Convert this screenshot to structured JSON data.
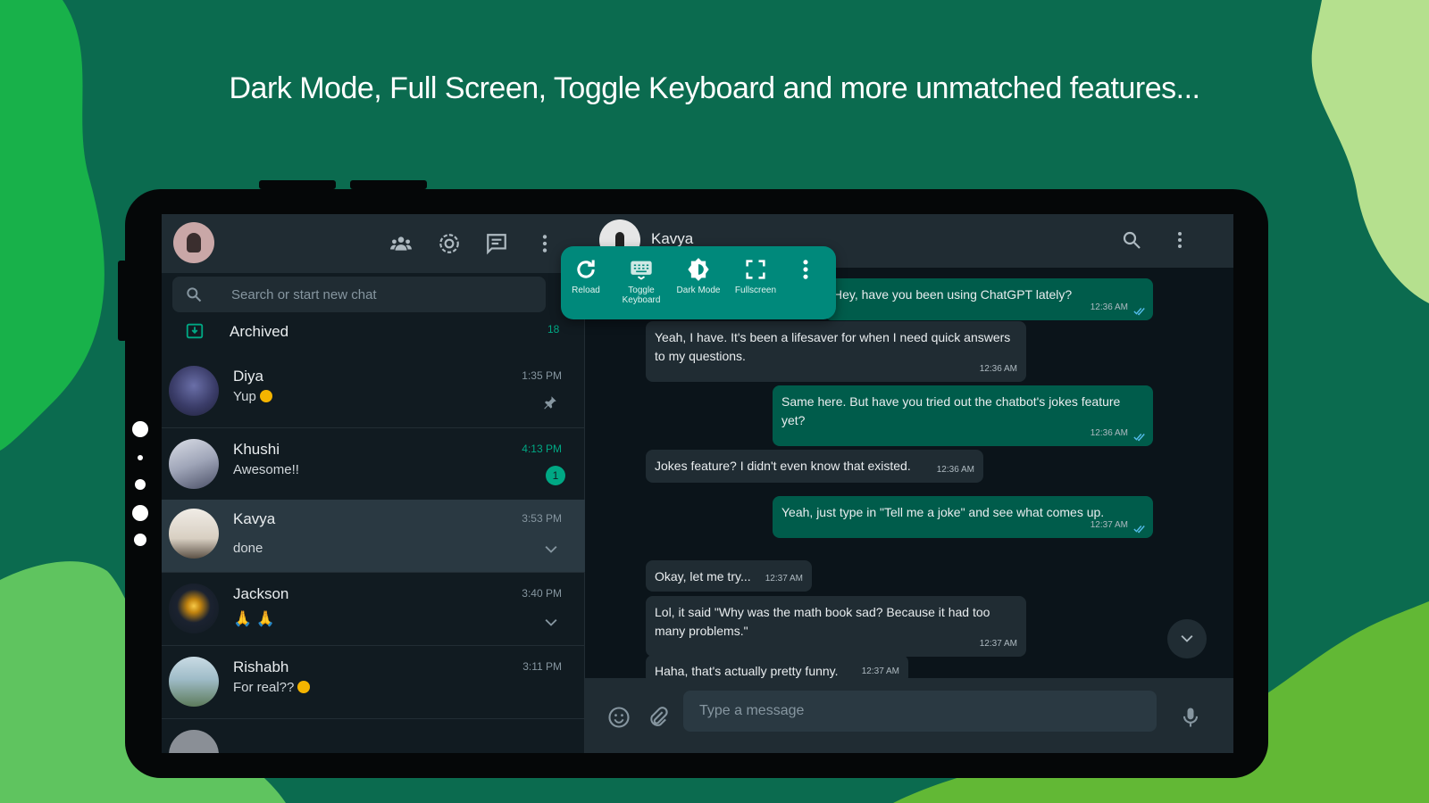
{
  "headline": "Dark Mode, Full Screen, Toggle Keyboard and more unmatched features...",
  "colors": {
    "background": "#0b6b4f",
    "accent": "#00a884",
    "bubble_out": "#005c4b",
    "bubble_in": "#202c33",
    "toolbar": "#00897b"
  },
  "sidebar": {
    "header_icons": [
      "community-icon",
      "status-icon",
      "new-chat-icon",
      "menu-icon"
    ],
    "search": {
      "placeholder": "Search or start new chat"
    },
    "archived": {
      "label": "Archived",
      "count": "18"
    },
    "chats": [
      {
        "name": "Diya",
        "message": "Yup",
        "time": "1:35 PM",
        "pinned": true
      },
      {
        "name": "Khushi",
        "message": "Awesome!!",
        "time": "4:13 PM",
        "unread": "1"
      },
      {
        "name": "Kavya",
        "message": "done",
        "time": "3:53 PM"
      },
      {
        "name": "Jackson",
        "message": "🙏 🙏",
        "time": "3:40 PM"
      },
      {
        "name": "Rishabh",
        "message": "For real??",
        "time": "3:11 PM"
      }
    ]
  },
  "conversation": {
    "contact_name": "Kavya",
    "messages": [
      {
        "dir": "out",
        "text": "Hey, have you been using ChatGPT lately?",
        "time": "12:36 AM"
      },
      {
        "dir": "in",
        "text": "Yeah, I have. It's been a lifesaver for when I need quick answers to my questions.",
        "time": "12:36 AM"
      },
      {
        "dir": "out",
        "text": "Same here. But have you tried out the chatbot's jokes feature yet?",
        "time": "12:36 AM"
      },
      {
        "dir": "in",
        "text": "Jokes feature? I didn't even know that existed.",
        "time": "12:36 AM"
      },
      {
        "dir": "out",
        "text": "Yeah, just type in \"Tell me a joke\" and see what comes up.",
        "time": "12:37 AM"
      },
      {
        "dir": "in",
        "text": "Okay, let me try...",
        "time": "12:37 AM"
      },
      {
        "dir": "in",
        "text": "Lol, it said \"Why was the math book sad? Because it had too many problems.\"",
        "time": "12:37 AM"
      },
      {
        "dir": "in",
        "text": "Haha, that's actually pretty funny.",
        "time": "12:37 AM"
      }
    ],
    "composer_placeholder": "Type a message"
  },
  "toolbar": {
    "buttons": [
      {
        "label": "Reload",
        "icon": "reload-icon"
      },
      {
        "label": "Toggle Keyboard",
        "icon": "keyboard-icon"
      },
      {
        "label": "Dark Mode",
        "icon": "brightness-icon"
      },
      {
        "label": "Fullscreen",
        "icon": "fullscreen-icon"
      }
    ]
  }
}
